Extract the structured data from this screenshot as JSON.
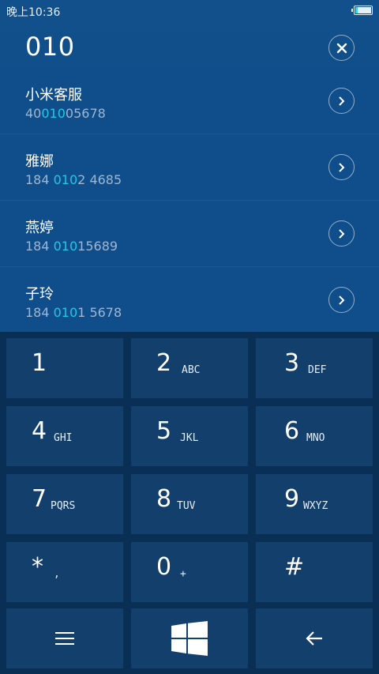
{
  "status": {
    "time": "晚上10:36",
    "battery_icon": "battery-icon"
  },
  "dial": {
    "number": "010",
    "clear_icon": "close-icon"
  },
  "contacts": [
    {
      "name": "小米客服",
      "phone_pre": "40",
      "phone_hl": "010",
      "phone_post": "05678"
    },
    {
      "name": "雅娜",
      "phone_pre": "184 ",
      "phone_hl": "010",
      "phone_post": "2 4685"
    },
    {
      "name": "燕婷",
      "phone_pre": "184 ",
      "phone_hl": "010",
      "phone_post": "15689"
    },
    {
      "name": "子玲",
      "phone_pre": "184 ",
      "phone_hl": "010",
      "phone_post": "1 5678"
    }
  ],
  "keypad": [
    {
      "digit": "1",
      "letters": ""
    },
    {
      "digit": "2",
      "letters": "ABC"
    },
    {
      "digit": "3",
      "letters": "DEF"
    },
    {
      "digit": "4",
      "letters": "GHI"
    },
    {
      "digit": "5",
      "letters": "JKL"
    },
    {
      "digit": "6",
      "letters": "MNO"
    },
    {
      "digit": "7",
      "letters": "PQRS"
    },
    {
      "digit": "8",
      "letters": "TUV"
    },
    {
      "digit": "9",
      "letters": "WXYZ"
    },
    {
      "digit": "*",
      "letters": ","
    },
    {
      "digit": "0",
      "letters": "+"
    },
    {
      "digit": "#",
      "letters": ""
    }
  ],
  "toolbar": {
    "menu_icon": "menu-icon",
    "windows_icon": "windows-logo-icon",
    "back_icon": "backspace-arrow-icon"
  },
  "colors": {
    "highlight": "#22c7e3",
    "key_bg": "#133f6c",
    "pad_bg": "#0a2f55",
    "list_bg": "#0f4e8a"
  }
}
